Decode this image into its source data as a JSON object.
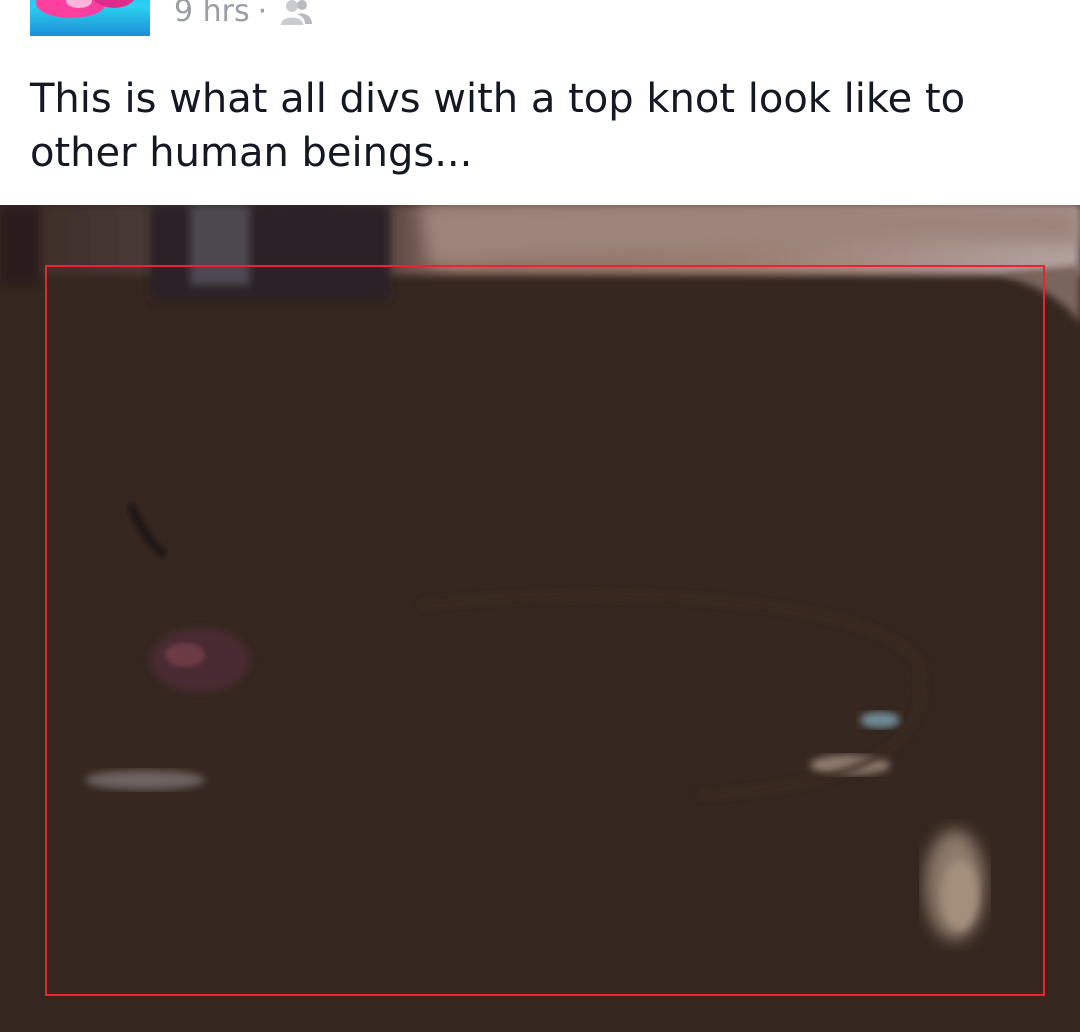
{
  "post": {
    "timestamp": "9 hrs",
    "separator": "·",
    "audience_icon": "friends-icon",
    "caption": "This is what all divs with a top knot look like to other human beings..."
  },
  "colors": {
    "caption_text": "#141823",
    "meta_text": "#9a9da3",
    "photo_base": "#35261f",
    "highlight_border": "#e8252c"
  }
}
